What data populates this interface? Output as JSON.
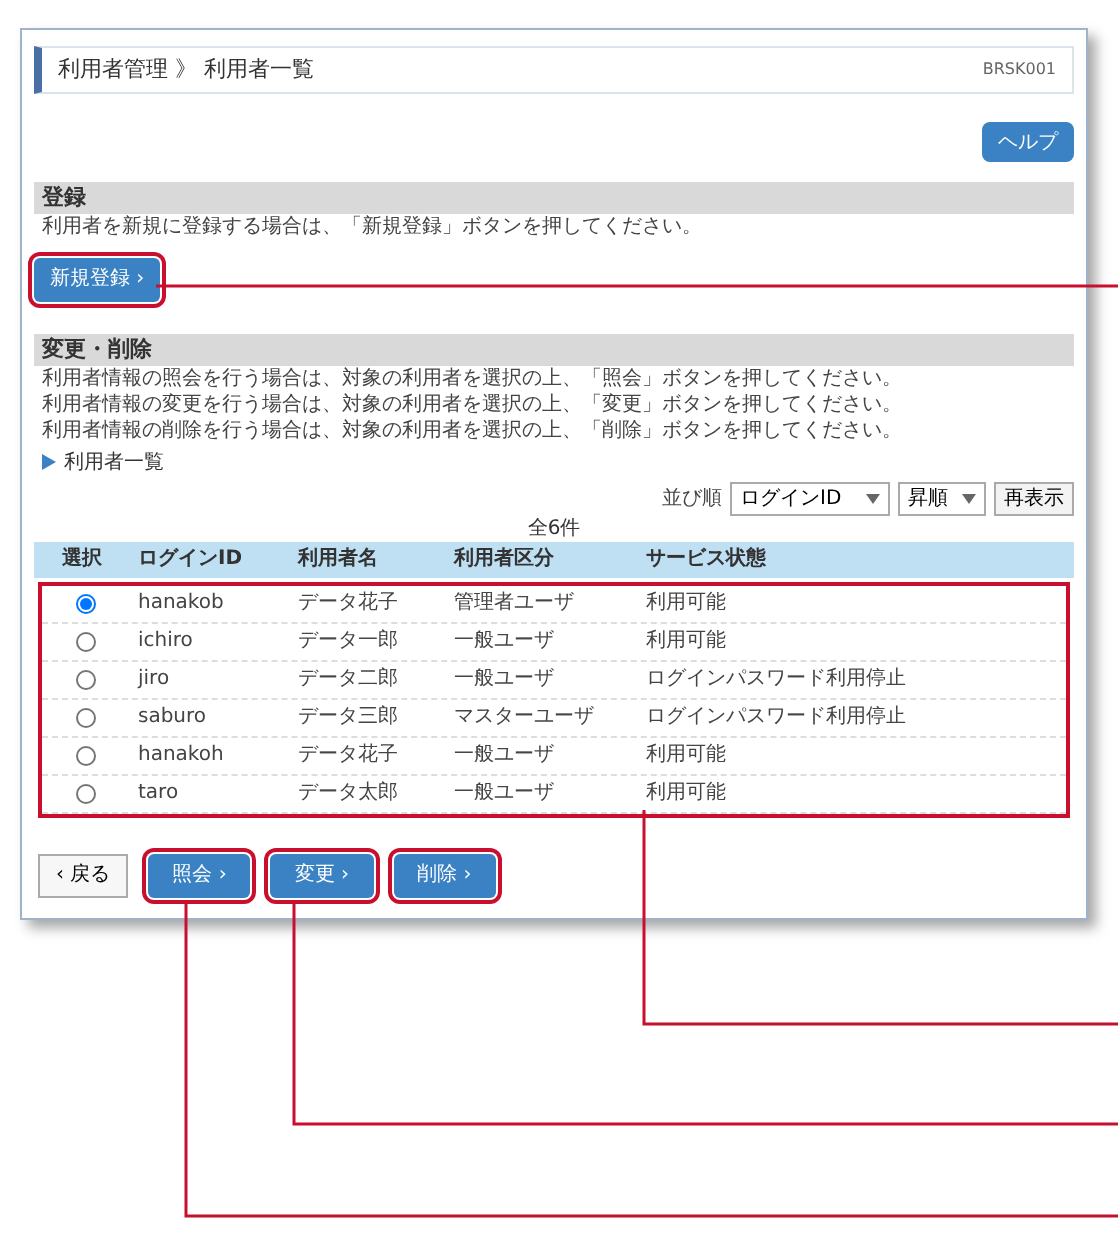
{
  "header": {
    "breadcrumb": [
      "利用者管理",
      "利用者一覧"
    ],
    "separator": "》",
    "screen_id": "BRSK001"
  },
  "help_button": "ヘルプ",
  "register": {
    "title": "登録",
    "description": "利用者を新規に登録する場合は、「新規登録」ボタンを押してください。",
    "button": "新規登録 ›"
  },
  "edit": {
    "title": "変更・削除",
    "descriptions": [
      "利用者情報の照会を行う場合は、対象の利用者を選択の上、「照会」ボタンを押してください。",
      "利用者情報の変更を行う場合は、対象の利用者を選択の上、「変更」ボタンを押してください。",
      "利用者情報の削除を行う場合は、対象の利用者を選択の上、「削除」ボタンを押してください。"
    ]
  },
  "list": {
    "title": "利用者一覧",
    "sort_label": "並び順",
    "sort_key": "ログインID",
    "sort_order": "昇順",
    "refresh_button": "再表示",
    "count": "全6件"
  },
  "table": {
    "select_column": "選択",
    "columns": [
      "ログインID",
      "利用者名",
      "利用者区分",
      "サービス状態"
    ],
    "rows": [
      {
        "selected": true,
        "cells": [
          "hanakob",
          "データ花子",
          "管理者ユーザ",
          "利用可能"
        ]
      },
      {
        "selected": false,
        "cells": [
          "ichiro",
          "データ一郎",
          "一般ユーザ",
          "利用可能"
        ]
      },
      {
        "selected": false,
        "cells": [
          "jiro",
          "データ二郎",
          "一般ユーザ",
          "ログインパスワード利用停止"
        ]
      },
      {
        "selected": false,
        "cells": [
          "saburo",
          "データ三郎",
          "マスターユーザ",
          "ログインパスワード利用停止"
        ]
      },
      {
        "selected": false,
        "cells": [
          "hanakoh",
          "データ花子",
          "一般ユーザ",
          "利用可能"
        ]
      },
      {
        "selected": false,
        "cells": [
          "taro",
          "データ太郎",
          "一般ユーザ",
          "利用可能"
        ]
      }
    ]
  },
  "footer": {
    "back_button": "‹ 戻る",
    "actions": [
      "照会 ›",
      "変更 ›",
      "削除 ›"
    ]
  }
}
